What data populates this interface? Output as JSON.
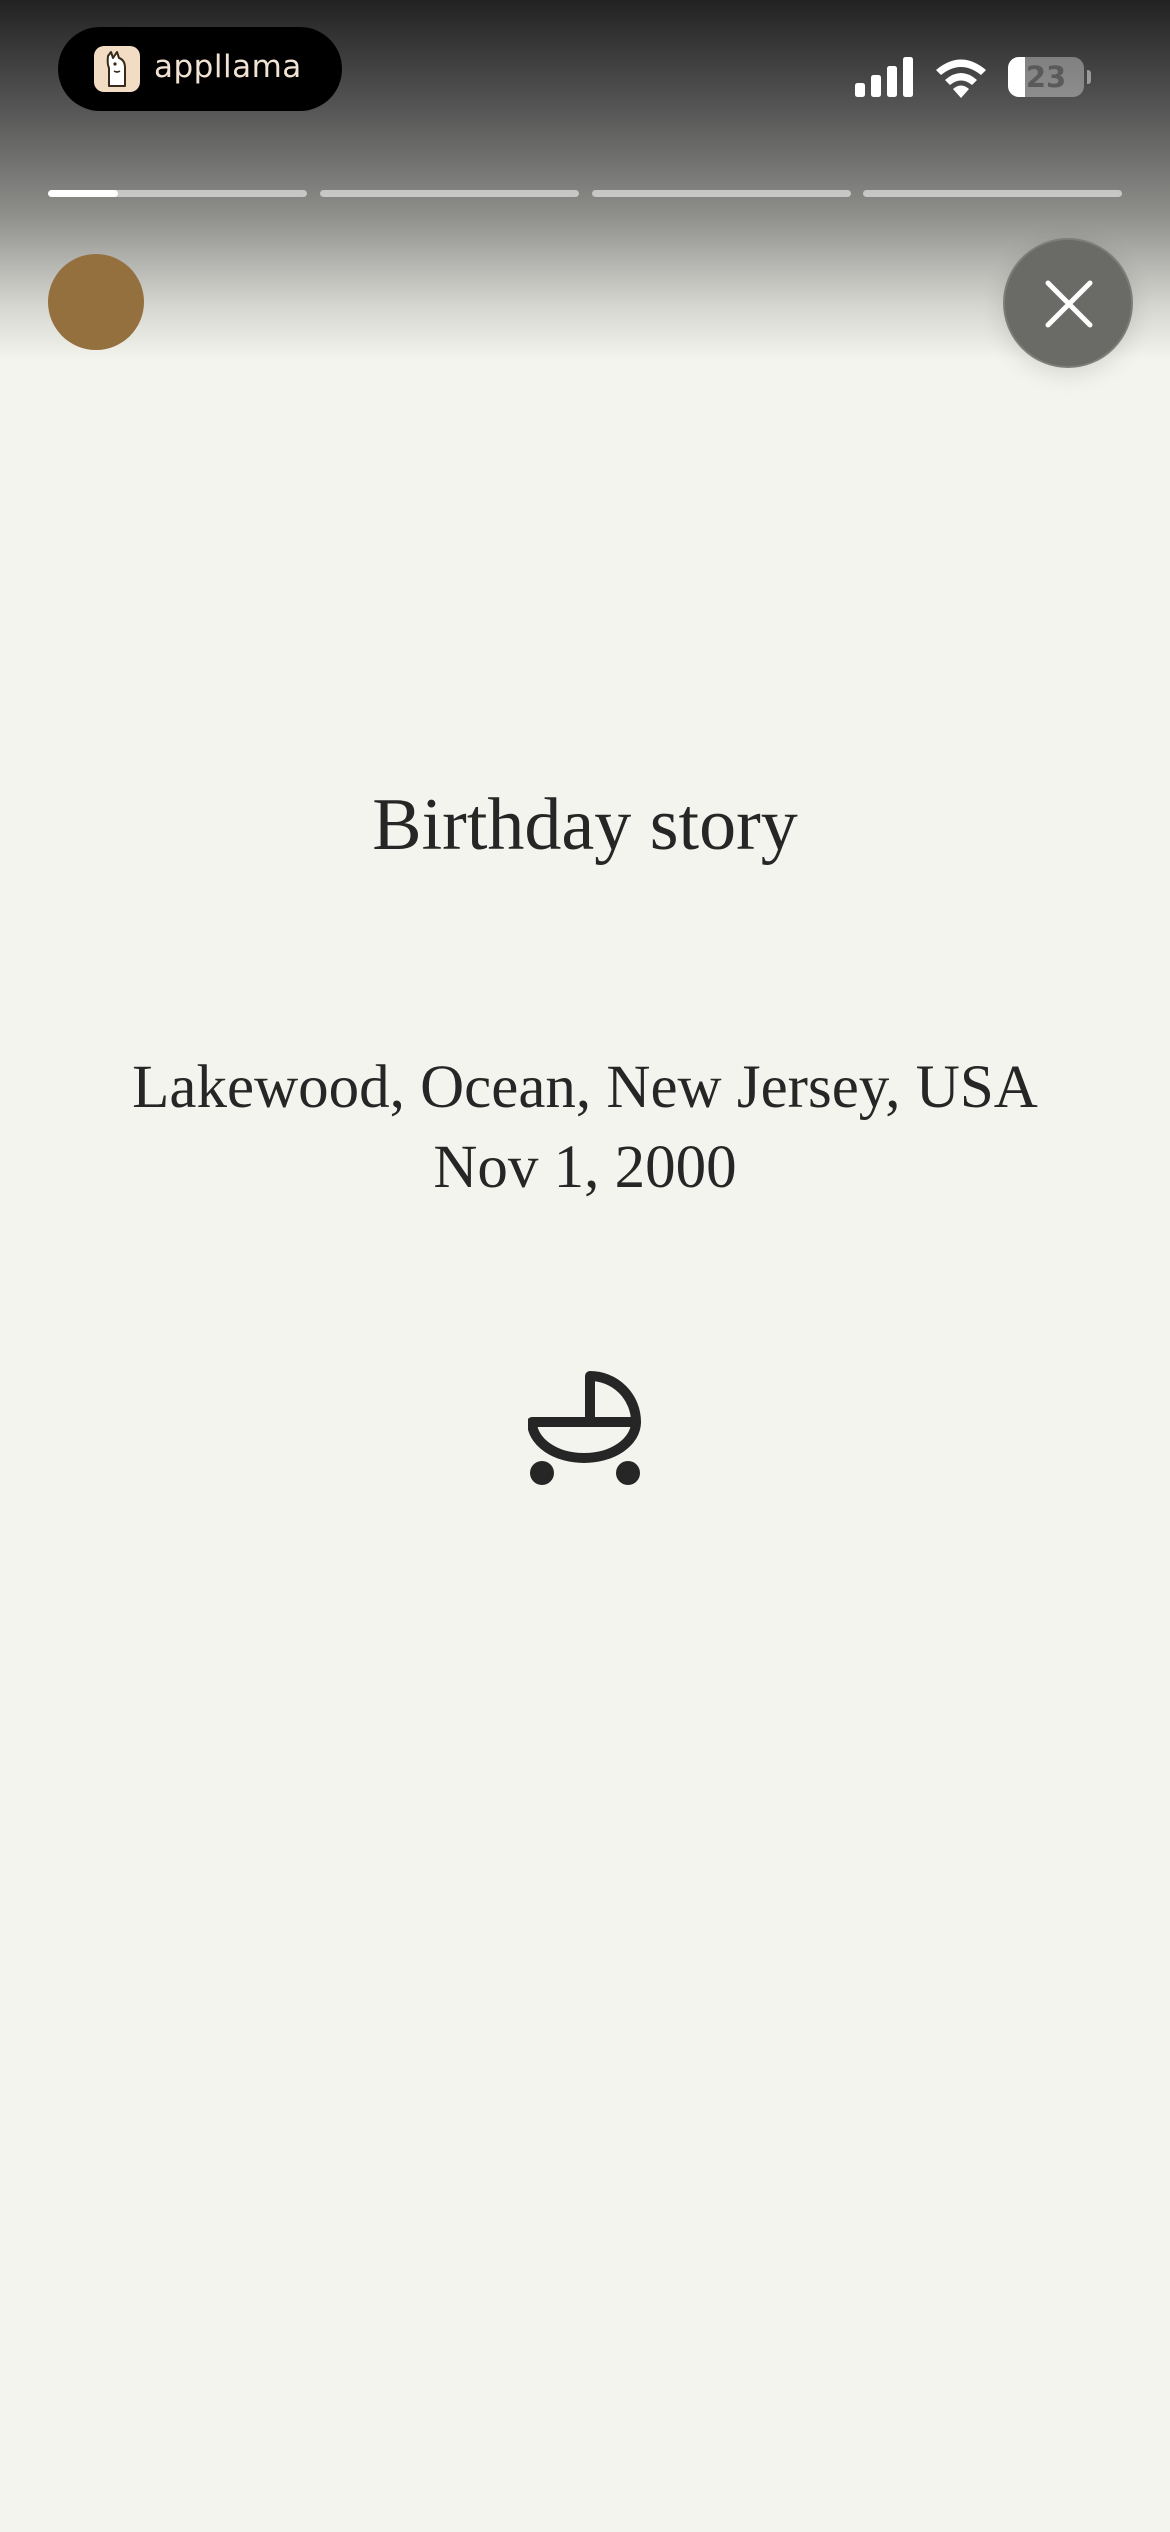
{
  "status_bar": {
    "app_name": "appllama",
    "battery_level": "23"
  },
  "story": {
    "segments": 4,
    "active_segment": 1,
    "active_progress": 0.27,
    "title": "Birthday story",
    "location": "Lakewood, Ocean, New Jersey, USA",
    "date": "Nov 1, 2000",
    "icon": "stroller-icon"
  },
  "colors": {
    "background": "#f4f4ee",
    "text": "#262626",
    "avatar": "#95703f",
    "close_button": "#6a6a67"
  }
}
